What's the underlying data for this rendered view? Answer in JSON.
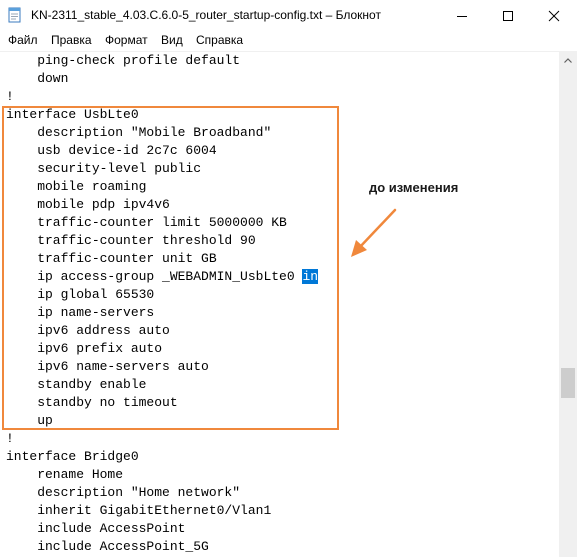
{
  "window": {
    "title": "KN-2311_stable_4.03.C.6.0-5_router_startup-config.txt – Блокнот",
    "icons": {
      "app": "notepad-icon",
      "minimize": "minimize-icon",
      "maximize": "maximize-icon",
      "close": "close-icon"
    }
  },
  "menu": [
    {
      "label": "Файл"
    },
    {
      "label": "Правка"
    },
    {
      "label": "Формат"
    },
    {
      "label": "Вид"
    },
    {
      "label": "Справка"
    }
  ],
  "editor": {
    "lines": [
      "    ping-check profile default",
      "    down",
      "!",
      "interface UsbLte0",
      "    description \"Mobile Broadband\"",
      "    usb device-id 2c7c 6004",
      "    security-level public",
      "    mobile roaming",
      "    mobile pdp ipv4v6",
      "    traffic-counter limit 5000000 KB",
      "    traffic-counter threshold 90",
      "    traffic-counter unit GB",
      "    ip access-group _WEBADMIN_UsbLte0 ",
      "    ip global 65530",
      "    ip name-servers",
      "    ipv6 address auto",
      "    ipv6 prefix auto",
      "    ipv6 name-servers auto",
      "    standby enable",
      "    standby no timeout",
      "    up",
      "!",
      "interface Bridge0",
      "    rename Home",
      "    description \"Home network\"",
      "    inherit GigabitEthernet0/Vlan1",
      "    include AccessPoint",
      "    include AccessPoint_5G"
    ],
    "selected_text": "in"
  },
  "annotation": {
    "text": "до изменения",
    "color": "#f0883c"
  },
  "colors": {
    "selection": "#0078d7",
    "highlight_border": "#f0883c"
  }
}
